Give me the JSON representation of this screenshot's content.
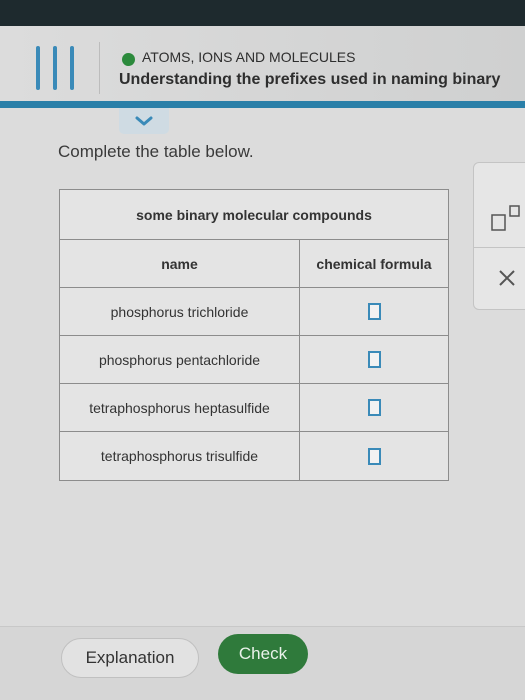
{
  "header": {
    "topic": "ATOMS, IONS AND MOLECULES",
    "subtitle": "Understanding the prefixes used in naming binary"
  },
  "instructions": "Complete the table below.",
  "table": {
    "title": "some binary molecular compounds",
    "columns": [
      "name",
      "chemical formula"
    ],
    "rows": [
      {
        "name": "phosphorus trichloride",
        "formula": ""
      },
      {
        "name": "phosphorus pentachloride",
        "formula": ""
      },
      {
        "name": "tetraphosphorus heptasulfide",
        "formula": ""
      },
      {
        "name": "tetraphosphorus trisulfide",
        "formula": ""
      }
    ]
  },
  "side_panel": {
    "close_symbol": "×"
  },
  "footer": {
    "explanation_label": "Explanation",
    "check_label": "Check"
  },
  "colors": {
    "accent_blue": "#3a8ab8",
    "status_green": "#2c8a3c",
    "check_green": "#2f7a3b"
  },
  "icons": [
    "hamburger-menu-icon",
    "status-dot-icon",
    "chevron-down-icon",
    "superscript-icon",
    "close-icon"
  ]
}
